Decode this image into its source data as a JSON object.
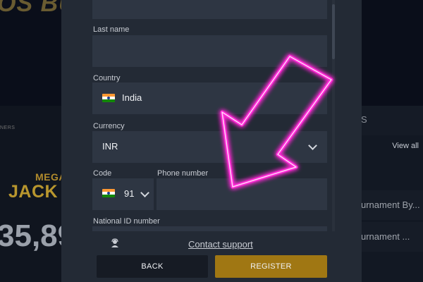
{
  "background": {
    "title": "OS BU",
    "small_text": "NERS",
    "mega_label": "MEGA",
    "jackpot_label": "JACK",
    "amount": "35,89",
    "right_header": "S",
    "view_all": "View all",
    "rows": [
      "urnament By...",
      "urnament ..."
    ]
  },
  "form": {
    "last_name": {
      "label": "Last name",
      "value": ""
    },
    "country": {
      "label": "Country",
      "value": "India",
      "flag_icon": "india-flag-icon"
    },
    "currency": {
      "label": "Currency",
      "value": "INR"
    },
    "code": {
      "label": "Code",
      "value": "91",
      "flag_icon": "india-flag-icon"
    },
    "phone": {
      "label": "Phone number",
      "value": ""
    },
    "national_id": {
      "label": "National ID number",
      "value": ""
    }
  },
  "support": {
    "label": "Contact support",
    "icon": "support-agent-icon"
  },
  "buttons": {
    "back": "BACK",
    "register": "REGISTER"
  },
  "colors": {
    "modal_bg": "#232a35",
    "field_bg": "#2e3643",
    "register_btn": "#a07713",
    "back_btn": "#161b24",
    "arrow_neon": "#ff2bd6"
  },
  "overlay": {
    "icon": "neon-arrow-icon"
  }
}
